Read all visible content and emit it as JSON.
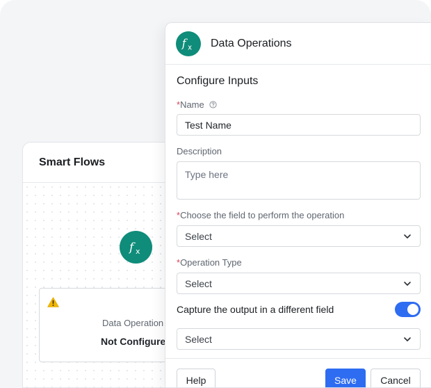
{
  "flows": {
    "title": "Smart Flows",
    "node": {
      "type_label": "Data Operation",
      "status": "Not Configured",
      "warning_icon": "warning-icon",
      "icon": "fx-icon"
    }
  },
  "panel": {
    "title": "Data Operations",
    "icon": "fx-icon",
    "section_title": "Configure Inputs",
    "name": {
      "required_mark": "*",
      "label": "Name",
      "value": "Test Name"
    },
    "description": {
      "label": "Description",
      "placeholder": "Type here"
    },
    "field_select": {
      "required_mark": "*",
      "label": "Choose the field to perform the operation",
      "value": "Select"
    },
    "operation_type": {
      "required_mark": "*",
      "label": "Operation Type",
      "value": "Select"
    },
    "capture": {
      "label": "Capture the output in a different field",
      "enabled": true
    },
    "output_select": {
      "value": "Select"
    },
    "footer": {
      "help_label": "Help",
      "save_label": "Save",
      "cancel_label": "Cancel"
    }
  },
  "colors": {
    "accent": "#2e6cf2",
    "fx_circle": "#0f8c7a",
    "required": "#d6455a",
    "warning": "#f2b705"
  }
}
